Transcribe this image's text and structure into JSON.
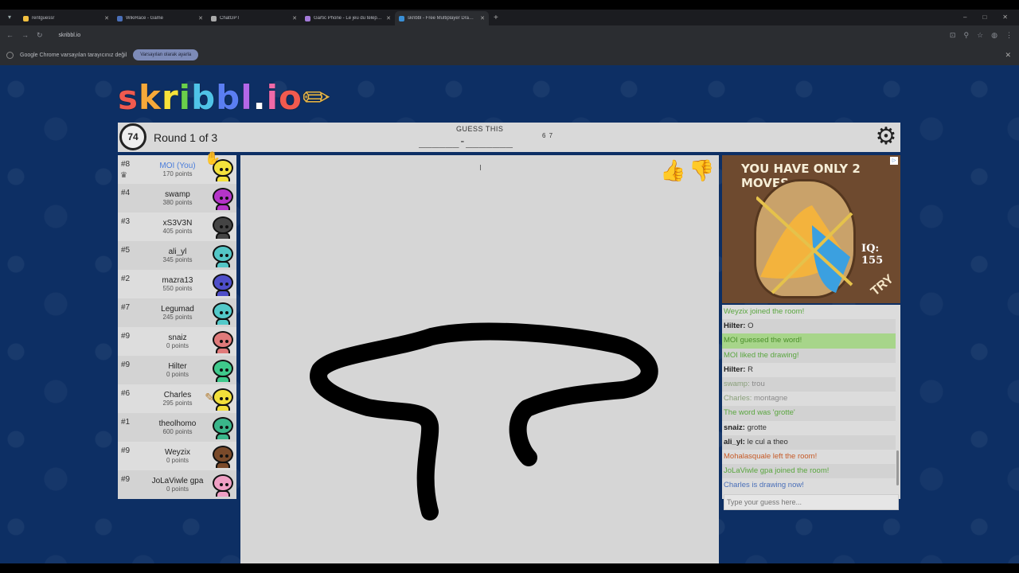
{
  "browser": {
    "tabs": [
      {
        "title": "rentguessr",
        "color": "#f2c040"
      },
      {
        "title": "WikiRace - Game",
        "color": "#4a6fb8"
      },
      {
        "title": "ChatGPT",
        "color": "#aaaaaa"
      },
      {
        "title": "Gartic Phone - Le jeu du téléphone",
        "color": "#a37ad8"
      },
      {
        "title": "skribbl - Free Multiplayer Drawing",
        "color": "#3a8fd6"
      }
    ],
    "url": "skribbl.io",
    "infobar_text": "Google Chrome varsayılan tarayıcınız değil",
    "infobar_button": "Varsayılan olarak ayarla"
  },
  "logo": "skribbl.io",
  "header": {
    "timer": "74",
    "round": "Round 1 of 3",
    "guess_label": "GUESS THIS",
    "hint": "______-_______",
    "hint_count": "6 7"
  },
  "players": [
    {
      "rank": "#8",
      "name": "MOI (You)",
      "points": "170 points",
      "you": true,
      "crown": true,
      "color": "#f4e23c",
      "hand": true
    },
    {
      "rank": "#4",
      "name": "swamp",
      "points": "380 points",
      "color": "#b534c9"
    },
    {
      "rank": "#3",
      "name": "xS3V3N",
      "points": "405 points",
      "color": "#444444"
    },
    {
      "rank": "#5",
      "name": "ali_yl",
      "points": "345 points",
      "color": "#54c6c6"
    },
    {
      "rank": "#2",
      "name": "mazra13",
      "points": "550 points",
      "color": "#4e4ec9"
    },
    {
      "rank": "#7",
      "name": "Legumad",
      "points": "245 points",
      "color": "#53c9c9"
    },
    {
      "rank": "#9",
      "name": "snaiz",
      "points": "0 points",
      "color": "#e07a7a"
    },
    {
      "rank": "#9",
      "name": "Hilter",
      "points": "0 points",
      "color": "#3fc98c"
    },
    {
      "rank": "#6",
      "name": "Charles",
      "points": "295 points",
      "color": "#f2df3a",
      "pencil": true
    },
    {
      "rank": "#1",
      "name": "theolhomo",
      "points": "600 points",
      "color": "#3ab58a"
    },
    {
      "rank": "#9",
      "name": "Weyzix",
      "points": "0 points",
      "color": "#7a4a2a"
    },
    {
      "rank": "#9",
      "name": "JoLaViwle gpa",
      "points": "0 points",
      "color": "#ef9fc4"
    }
  ],
  "ad": {
    "title": "YOU HAVE ONLY 2 MOVES",
    "iq": "IQ: 155",
    "cta": "TRY"
  },
  "chat": {
    "messages": [
      {
        "type": "green",
        "text": "Weyzix joined the room!"
      },
      {
        "type": "normal",
        "who": "Hilter:",
        "text": "O"
      },
      {
        "type": "green-bg",
        "text": "MOI guessed the word!"
      },
      {
        "type": "green",
        "text": "MOI liked the drawing!"
      },
      {
        "type": "normal",
        "who": "Hilter:",
        "text": "R"
      },
      {
        "type": "faded",
        "who": "swamp:",
        "text": "trou"
      },
      {
        "type": "faded",
        "who": "Charles:",
        "text": "montagne"
      },
      {
        "type": "green",
        "text": "The word was 'grotte'"
      },
      {
        "type": "normal",
        "who": "snaiz:",
        "text": "grotte"
      },
      {
        "type": "normal",
        "who": "ali_yl:",
        "text": "le cul a theo"
      },
      {
        "type": "red",
        "text": "Mohalasquale left the room!"
      },
      {
        "type": "green",
        "text": "JoLaViwle gpa joined the room!"
      },
      {
        "type": "blue",
        "text": "Charles is drawing now!"
      }
    ],
    "input_placeholder": "Type your guess here..."
  },
  "colors": {
    "page_bg": "#0d2f64",
    "panel": "#d9d9d9",
    "stroke": "#000000"
  },
  "icons": [
    "clock-icon",
    "settings-gear-icon",
    "thumbs-up-icon",
    "thumbs-down-icon",
    "crown-icon",
    "pencil-icon"
  ]
}
